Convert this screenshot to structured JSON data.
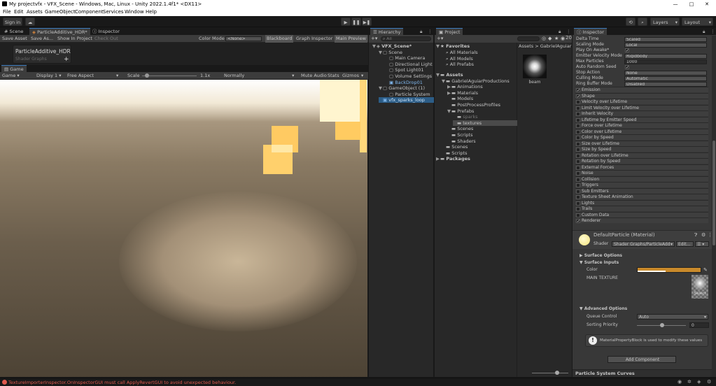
{
  "window": {
    "title": "My projectvfx - VFX_Scene - Windows, Mac, Linux - Unity 2022.1.4f1* <DX11>",
    "controls": [
      "—",
      "□",
      "✕"
    ]
  },
  "menu": [
    "File",
    "Edit",
    "Assets",
    "GameObject",
    "Component",
    "Services",
    "Window",
    "Help"
  ],
  "toolbar": {
    "sign_in": "Sign in",
    "layers": "Layers",
    "layout": "Layout"
  },
  "left_tabs": {
    "scene": "Scene",
    "shadergraph": "ParticleAdditive_HDR*",
    "inspector": "Inspector"
  },
  "shadergraph": {
    "save_asset": "Save Asset",
    "save_as": "Save As...",
    "show_in_project": "Show In Project",
    "check_out": "Check Out",
    "color_mode_label": "Color Mode",
    "color_mode_value": "<None>",
    "blackboard": "Blackboard",
    "graph_inspector": "Graph Inspector",
    "main_preview": "Main Preview",
    "blackboard_title": "ParticleAdditive_HDR",
    "blackboard_subtitle": "Shader Graphs",
    "add": "+"
  },
  "game": {
    "tab": "Game",
    "view_mode": "Game",
    "display": "Display 1",
    "aspect": "Free Aspect",
    "scale_label": "Scale",
    "scale_value": "1.1x",
    "render_mode": "Normally",
    "mute_audio": "Mute Audio",
    "stats": "Stats",
    "gizmos": "Gizmos"
  },
  "hierarchy": {
    "tab": "Hierarchy",
    "search_placeholder": "All",
    "items": [
      {
        "label": "VFX_Scene*",
        "depth": 0,
        "fold": "▼",
        "type": "scene"
      },
      {
        "label": "Scene",
        "depth": 1,
        "fold": "▼",
        "type": "go"
      },
      {
        "label": "Main Camera",
        "depth": 2,
        "fold": "",
        "type": "go"
      },
      {
        "label": "Directional Light",
        "depth": 2,
        "fold": "",
        "type": "go"
      },
      {
        "label": "Spot Light01",
        "depth": 2,
        "fold": "",
        "type": "go"
      },
      {
        "label": "Volume Settings",
        "depth": 2,
        "fold": "",
        "type": "go"
      },
      {
        "label": "BackDrop01",
        "depth": 2,
        "fold": "",
        "type": "prefab"
      },
      {
        "label": "GameObject (1)",
        "depth": 1,
        "fold": "▼",
        "type": "go"
      },
      {
        "label": "Particle System",
        "depth": 2,
        "fold": "",
        "type": "go"
      },
      {
        "label": "vfx_sparks_loop",
        "depth": 1,
        "fold": "",
        "type": "prefab-selected"
      }
    ]
  },
  "project": {
    "tab": "Project",
    "breadcrumb_root": "Assets",
    "breadcrumb_sep": ">",
    "breadcrumb_folder": "GabrielAguiarPro",
    "badge": "20",
    "favorites_label": "Favorites",
    "favorites": [
      "All Materials",
      "All Models",
      "All Prefabs"
    ],
    "tree": [
      {
        "label": "Assets",
        "depth": 0,
        "fold": "▼",
        "bold": true
      },
      {
        "label": "GabrielAguiarProductions",
        "depth": 1,
        "fold": "▼"
      },
      {
        "label": "Animations",
        "depth": 2,
        "fold": "▶"
      },
      {
        "label": "Materials",
        "depth": 2,
        "fold": "▶"
      },
      {
        "label": "Models",
        "depth": 2,
        "fold": ""
      },
      {
        "label": "PostProcessProfiles",
        "depth": 2,
        "fold": ""
      },
      {
        "label": "Prefabs",
        "depth": 2,
        "fold": "▼"
      },
      {
        "label": "sparks",
        "depth": 3,
        "fold": "",
        "dim": true
      },
      {
        "label": "textures",
        "depth": 3,
        "fold": "",
        "selected": true
      },
      {
        "label": "Scenes",
        "depth": 2,
        "fold": ""
      },
      {
        "label": "Scripts",
        "depth": 2,
        "fold": ""
      },
      {
        "label": "Shaders",
        "depth": 2,
        "fold": ""
      },
      {
        "label": "Scenes",
        "depth": 1,
        "fold": ""
      },
      {
        "label": "Scripts",
        "depth": 1,
        "fold": ""
      },
      {
        "label": "Packages",
        "depth": 0,
        "fold": "▶",
        "bold": true
      }
    ],
    "asset_name": "beam"
  },
  "inspector": {
    "tab": "Inspector",
    "props": [
      {
        "label": "Delta Time",
        "value": "Scaled",
        "kind": "dropdown"
      },
      {
        "label": "Scaling Mode",
        "value": "Local",
        "kind": "dropdown"
      },
      {
        "label": "Play On Awake*",
        "value": "✓",
        "kind": "check"
      },
      {
        "label": "Emitter Velocity Mode",
        "value": "Rigidbody",
        "kind": "dropdown"
      },
      {
        "label": "Max Particles",
        "value": "1000",
        "kind": "field"
      },
      {
        "label": "Auto Random Seed",
        "value": "✓",
        "kind": "check"
      },
      {
        "label": "Stop Action",
        "value": "None",
        "kind": "dropdown"
      },
      {
        "label": "Culling Mode",
        "value": "Automatic",
        "kind": "dropdown"
      },
      {
        "label": "Ring Buffer Mode",
        "value": "Disabled",
        "kind": "dropdown"
      }
    ],
    "modules": [
      {
        "label": "Emission",
        "checked": true
      },
      {
        "label": "Shape",
        "checked": true
      },
      {
        "label": "Velocity over Lifetime",
        "checked": false
      },
      {
        "label": "Limit Velocity over Lifetime",
        "checked": false
      },
      {
        "label": "Inherit Velocity",
        "checked": false
      },
      {
        "label": "Lifetime by Emitter Speed",
        "checked": false
      },
      {
        "label": "Force over Lifetime",
        "checked": false
      },
      {
        "label": "Color over Lifetime",
        "checked": false
      },
      {
        "label": "Color by Speed",
        "checked": false
      },
      {
        "label": "Size over Lifetime",
        "checked": false
      },
      {
        "label": "Size by Speed",
        "checked": false
      },
      {
        "label": "Rotation over Lifetime",
        "checked": false
      },
      {
        "label": "Rotation by Speed",
        "checked": false
      },
      {
        "label": "External Forces",
        "checked": false
      },
      {
        "label": "Noise",
        "checked": false
      },
      {
        "label": "Collision",
        "checked": false
      },
      {
        "label": "Triggers",
        "checked": false
      },
      {
        "label": "Sub Emitters",
        "checked": false
      },
      {
        "label": "Texture Sheet Animation",
        "checked": false
      },
      {
        "label": "Lights",
        "checked": false
      },
      {
        "label": "Trails",
        "checked": false
      },
      {
        "label": "Custom Data",
        "checked": false
      },
      {
        "label": "Renderer",
        "checked": true
      }
    ],
    "material": {
      "name": "DefaultParticle (Material)",
      "shader_label": "Shader",
      "shader_value": "Shader Graphs/ParticleAdd",
      "edit": "Edit...",
      "menu": "☰",
      "surface_options": "Surface Options",
      "surface_inputs": "Surface Inputs",
      "color_label": "Color",
      "color_value": "#c98a2b",
      "main_texture": "MAIN TEXTURE",
      "select": "Select",
      "advanced": "Advanced Options",
      "queue_label": "Queue Control",
      "queue_value": "Auto",
      "priority_label": "Sorting Priority",
      "priority_value": "0",
      "info": "MaterialPropertyBlock is used to modify these values",
      "add_component": "Add Component"
    },
    "footer": "Particle System Curves"
  },
  "status": {
    "error": "TextureImporterInspector.OnInspectorGUI must call ApplyRevertGUI to avoid unexpected behaviour."
  },
  "colors": {
    "accent": "#3a79bb",
    "error": "#e05a4f",
    "selected": "#2c5d87",
    "light": "#f7c468"
  }
}
